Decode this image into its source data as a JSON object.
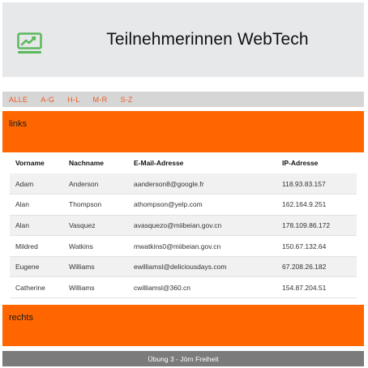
{
  "header": {
    "title": "Teilnehmerinnen WebTech",
    "logo_icon": "chart-monitor-icon",
    "accent": "#5cb85c"
  },
  "filters": [
    "ALLE",
    "A-G",
    "H-L",
    "M-R",
    "S-Z"
  ],
  "panels": {
    "links": "links",
    "rechts": "rechts",
    "color": "#ff6600"
  },
  "table": {
    "headers": [
      "Vorname",
      "Nachname",
      "E-Mail-Adresse",
      "IP-Adresse"
    ],
    "rows": [
      [
        "Adam",
        "Anderson",
        "aanderson8@google.fr",
        "118.93.83.157"
      ],
      [
        "Alan",
        "Thompson",
        "athompson@yelp.com",
        "162.164.9.251"
      ],
      [
        "Alan",
        "Vasquez",
        "avasquezo@miibeian.gov.cn",
        "178.109.86.172"
      ],
      [
        "Mildred",
        "Watkins",
        "mwatkins0@miibeian.gov.cn",
        "150.67.132.64"
      ],
      [
        "Eugene",
        "Williams",
        "ewilliamsl@deliciousdays.com",
        "67.208.26.182"
      ],
      [
        "Catherine",
        "Williams",
        "cwilliamsl@360.cn",
        "154.87.204.51"
      ]
    ]
  },
  "footer": {
    "text": "Übung 3 - Jörn Freiheit"
  }
}
